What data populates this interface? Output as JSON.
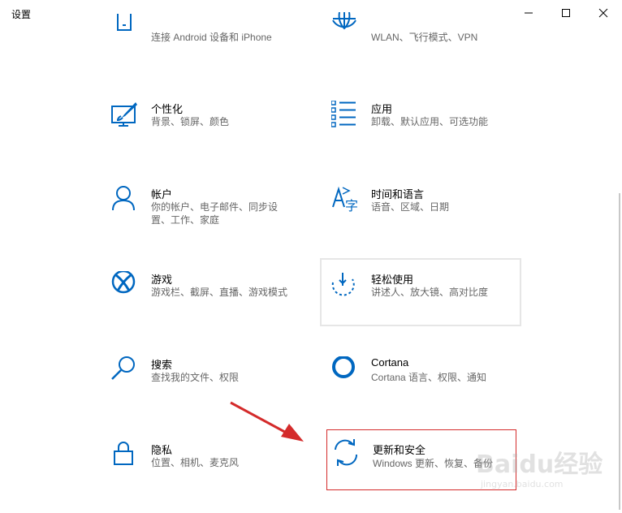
{
  "window": {
    "title": "设置"
  },
  "tiles": {
    "phone": {
      "desc": "连接 Android 设备和 iPhone"
    },
    "network": {
      "desc": "WLAN、飞行模式、VPN"
    },
    "personalize": {
      "name": "个性化",
      "desc": "背景、锁屏、颜色"
    },
    "apps": {
      "name": "应用",
      "desc": "卸载、默认应用、可选功能"
    },
    "accounts": {
      "name": "帐户",
      "desc1": "你的帐户、电子邮件、同步设",
      "desc2": "置、工作、家庭"
    },
    "time_language": {
      "name": "时间和语言",
      "desc": "语音、区域、日期"
    },
    "gaming": {
      "name": "游戏",
      "desc": "游戏栏、截屏、直播、游戏模式"
    },
    "ease_access": {
      "name": "轻松使用",
      "desc": "讲述人、放大镜、高对比度"
    },
    "search": {
      "name": "搜索",
      "desc": "查找我的文件、权限"
    },
    "cortana": {
      "name": "Cortana",
      "desc": "Cortana 语言、权限、通知"
    },
    "privacy": {
      "name": "隐私",
      "desc": "位置、相机、麦克风"
    },
    "update": {
      "name": "更新和安全",
      "desc": "Windows 更新、恢复、备份"
    }
  },
  "watermark": {
    "text": "Baidu经验",
    "sub": "jingyan.baidu.com"
  },
  "colors": {
    "accent": "#0067c0",
    "annotation": "#d42b2b",
    "muted": "#666666"
  }
}
